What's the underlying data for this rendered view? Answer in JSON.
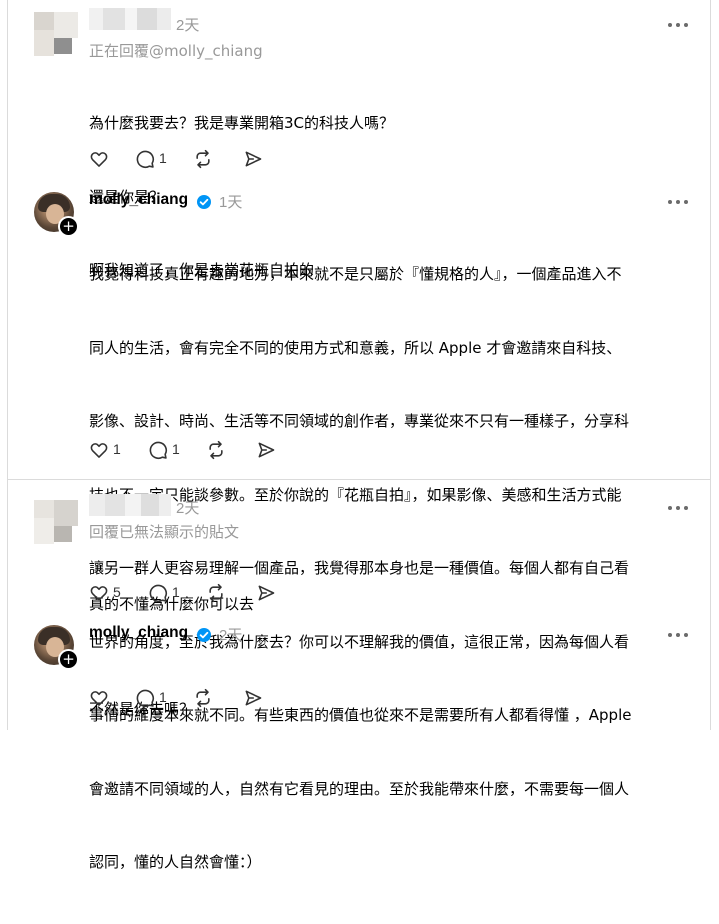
{
  "posts": [
    {
      "username": "",
      "time": "2天",
      "replying": "正在回覆@molly_chiang",
      "lines": [
        "為什麼我要去？我是專業開箱3C的科技人嗎？",
        "還是你是？",
        "啊我知道了，你是去當花瓶自拍的"
      ],
      "likes": "",
      "replies": "1"
    },
    {
      "username": "molly_chiang",
      "verified": true,
      "time": "1天",
      "lines": [
        "我覺得科技真正有趣的地方，本來就不是只屬於『懂規格的人』，一個產品進入不",
        "同人的生活，會有完全不同的使用方式和意義，所以 Apple 才會邀請來自科技、",
        "影像、設計、時尚、生活等不同領域的創作者，專業從來不只有一種樣子，分享科",
        "技也不一定只能談參數。至於你說的『花瓶自拍』，如果影像、美感和生活方式能",
        "讓另一群人更容易理解一個產品，我覺得那本身也是一種價值。每個人都有自己看",
        "世界的角度，至於我為什麼去？你可以不理解我的價值，這很正常，因為每個人看",
        "事情的維度本來就不同。有些東西的價值也從來不是需要所有人都看得懂 ，Apple",
        "會邀請不同領域的人，自然有它看見的理由。至於我能帶來什麼，不需要每一個人",
        "認同，懂的人自然會懂：）"
      ],
      "likes": "1",
      "replies": "1"
    },
    {
      "username": "",
      "time": "2天",
      "replying": "回覆已無法顯示的貼文",
      "lines": [
        "真的不懂為什麼你可以去"
      ],
      "likes": "5",
      "replies": "1"
    },
    {
      "username": "molly_chiang",
      "verified": true,
      "time": "2天",
      "lines": [
        "不然是你去嗎？"
      ],
      "likes": "",
      "replies": "1"
    }
  ],
  "icons": {
    "like": "heart-icon",
    "reply": "comment-icon",
    "repost": "repost-icon",
    "share": "share-icon",
    "more": "more-icon",
    "verified": "verified-badge-icon",
    "follow": "plus-icon"
  },
  "colors": {
    "verified": "#0095f6",
    "muted": "#999999",
    "divider": "#dbdbdb"
  }
}
